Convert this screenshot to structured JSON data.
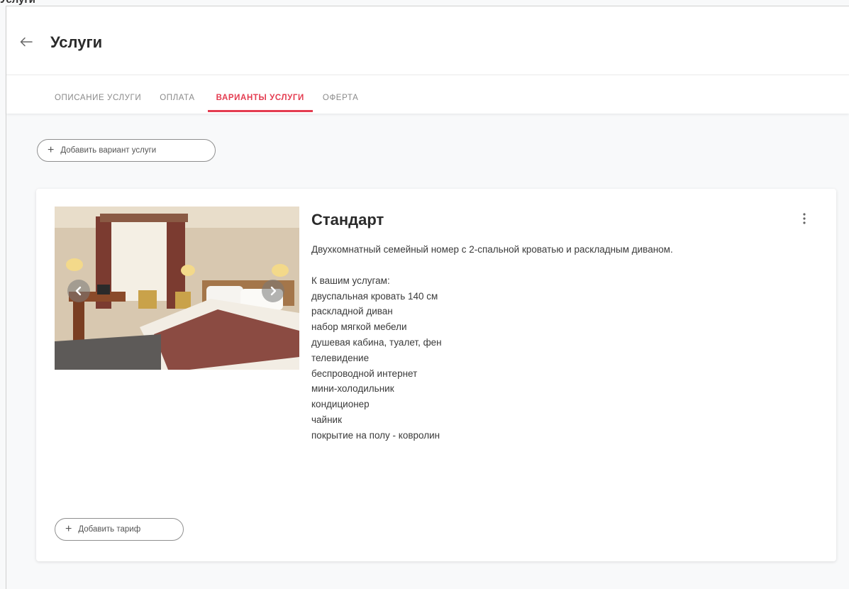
{
  "top_crumb": "Услуги",
  "header": {
    "title": "Услуги"
  },
  "tabs": [
    {
      "label": "ОПИСАНИЕ УСЛУГИ",
      "active": false
    },
    {
      "label": "ОПЛАТА",
      "active": false
    },
    {
      "label": "ВАРИАНТЫ УСЛУГИ",
      "active": true
    },
    {
      "label": "ОФЕРТА",
      "active": false
    }
  ],
  "actions": {
    "add_variant_label": "Добавить вариант услуги"
  },
  "variant": {
    "title": "Стандарт",
    "description": "Двухкомнатный семейный номер с 2-спальной кроватью и раскладным диваном.",
    "amenities_heading": "К вашим услугам:",
    "amenities": [
      "двуспальная кровать 140 см",
      "раскладной диван",
      "набор мягкой мебели",
      "душевая кабина, туалет, фен",
      "телевидение",
      "беспроводной интернет",
      "мини-холодильник",
      "кондиционер",
      "чайник",
      "покрытие на полу - ковролин"
    ],
    "add_tariff_label": "Добавить тариф"
  },
  "colors": {
    "accent": "#e43c50",
    "tab_inactive": "#8a8a8a",
    "text": "#333333",
    "background": "#f8f9fa"
  },
  "icons": {
    "back": "arrow-left-icon",
    "plus": "plus-icon",
    "more": "more-vertical-icon",
    "prev": "chevron-left-icon",
    "next": "chevron-right-icon"
  }
}
